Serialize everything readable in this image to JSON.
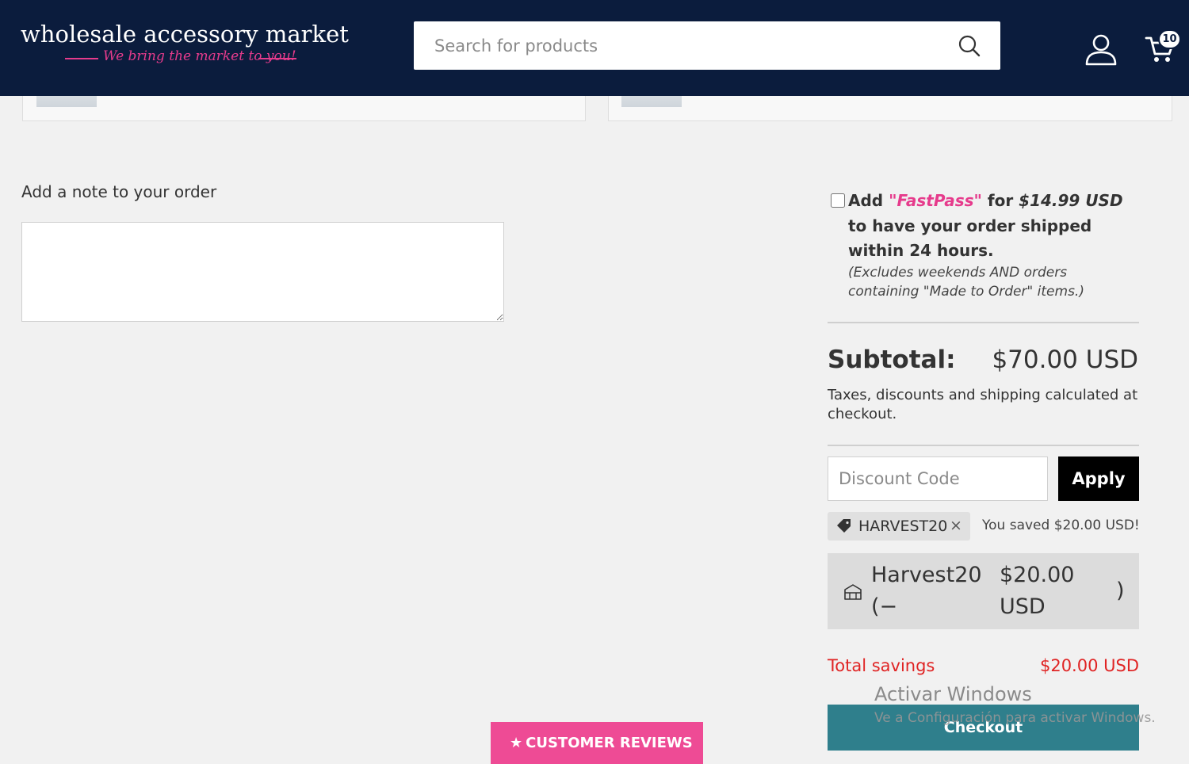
{
  "header": {
    "logo_main": "wholesale accessory market",
    "logo_tagline": "We bring the market to you!",
    "search_placeholder": "Search for products",
    "cart_count": "10",
    "brand_color": "#0b1c3d",
    "accent_color": "#e63b8c"
  },
  "note": {
    "label": "Add a note to your order",
    "value": ""
  },
  "fastpass": {
    "checked": false,
    "prefix": "Add ",
    "name": "\"FastPass\"",
    "mid": " for ",
    "price": "$14.99 USD",
    "suffix": " to have your order shipped within 24 hours.",
    "note": "(Excludes weekends AND orders containing \"Made to Order\" items.)"
  },
  "summary": {
    "subtotal_label": "Subtotal:",
    "subtotal_value": "$70.00 USD",
    "tax_note": "Taxes, discounts and shipping calculated at checkout.",
    "discount_placeholder": "Discount Code",
    "apply_label": "Apply",
    "applied_code": "HARVEST20",
    "applied_close": "×",
    "saved_text": "You saved $20.00 USD!",
    "discount_line_name": "Harvest20 (−",
    "discount_line_amount": "$20.00 USD",
    "discount_line_close": ")",
    "total_savings_label": "Total savings",
    "total_savings_value": "$20.00 USD",
    "checkout_label": "Checkout",
    "checkout_color": "#2f7f8c",
    "savings_color": "#e02424"
  },
  "watermark": {
    "title": "Activar Windows",
    "subtitle": "Ve a Configuración para activar Windows."
  },
  "reviews_tab": {
    "icon": "star-icon",
    "label": "CUSTOMER REVIEWS",
    "color": "#ee4b95"
  }
}
